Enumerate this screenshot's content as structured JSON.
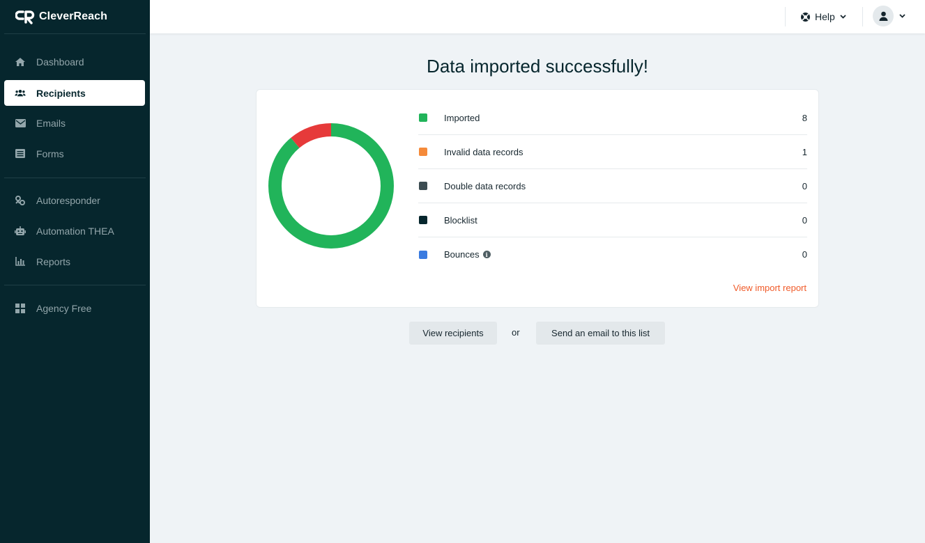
{
  "app": {
    "name": "CleverReach"
  },
  "sidebar": {
    "items": [
      {
        "label": "Dashboard",
        "icon": "home-icon"
      },
      {
        "label": "Recipients",
        "icon": "users-icon",
        "active": true
      },
      {
        "label": "Emails",
        "icon": "envelope-icon"
      },
      {
        "label": "Forms",
        "icon": "form-icon"
      },
      {
        "label": "Autoresponder",
        "icon": "autoresponder-icon"
      },
      {
        "label": "Automation THEA",
        "icon": "robot-icon"
      },
      {
        "label": "Reports",
        "icon": "chart-icon"
      },
      {
        "label": "Agency Free",
        "icon": "grid-icon"
      }
    ]
  },
  "topbar": {
    "help_label": "Help"
  },
  "main": {
    "title": "Data imported successfully!",
    "stats": [
      {
        "label": "Imported",
        "value": "8",
        "color": "#21b45a"
      },
      {
        "label": "Invalid data records",
        "value": "1",
        "color": "#f58a3a"
      },
      {
        "label": "Double data records",
        "value": "0",
        "color": "#3d4d52"
      },
      {
        "label": "Blocklist",
        "value": "0",
        "color": "#06262d"
      },
      {
        "label": "Bounces",
        "value": "0",
        "color": "#3a7be0"
      }
    ],
    "report_link": "View import report",
    "view_recipients_label": "View recipients",
    "or_label": "or",
    "send_email_label": "Send an email to this list"
  },
  "chart_data": {
    "type": "pie",
    "style": "donut",
    "categories": [
      "Imported",
      "Invalid data records"
    ],
    "values": [
      8,
      1
    ],
    "colors": [
      "#21b45a",
      "#e63a3a"
    ]
  }
}
